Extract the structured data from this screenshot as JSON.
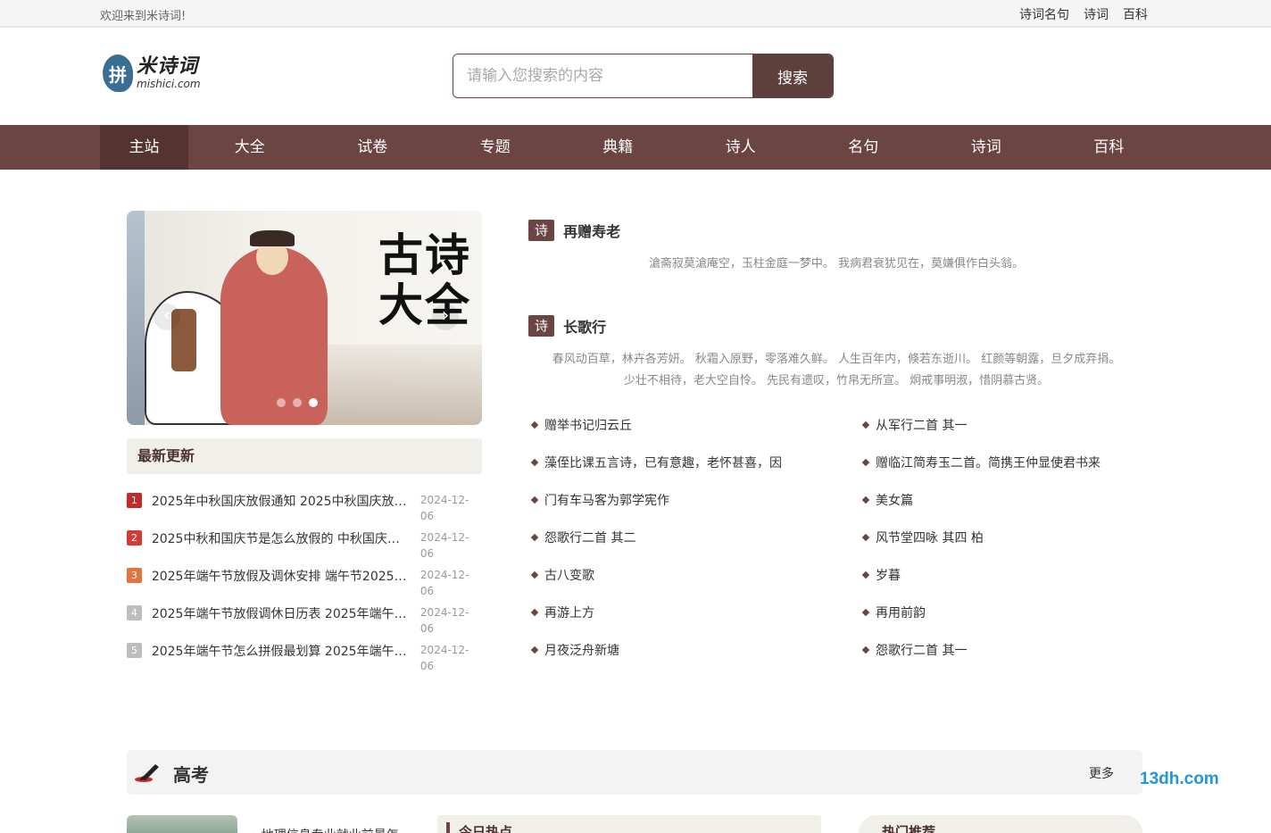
{
  "topbar": {
    "welcome": "欢迎来到米诗词!",
    "links": [
      "诗词名句",
      "诗词",
      "百科"
    ]
  },
  "logo": {
    "mark": "拼",
    "cn": "米诗词",
    "en": "mishici.com"
  },
  "search": {
    "placeholder": "请输入您搜索的内容",
    "button": "搜索"
  },
  "nav": [
    "主站",
    "大全",
    "试卷",
    "专题",
    "典籍",
    "诗人",
    "名句",
    "诗词",
    "百科"
  ],
  "banner": {
    "title_line1": "古诗",
    "title_line2": "大全"
  },
  "news": {
    "heading": "最新更新",
    "items": [
      {
        "rank": "1",
        "title": "2025年中秋国庆放假通知 2025中秋国庆放…",
        "date": "2024-12-06"
      },
      {
        "rank": "2",
        "title": "2025中秋和国庆节是怎么放假的 中秋国庆…",
        "date": "2024-12-06"
      },
      {
        "rank": "3",
        "title": "2025年端午节放假及调休安排 端午节2025…",
        "date": "2024-12-06"
      },
      {
        "rank": "4",
        "title": "2025年端午节放假调休日历表 2025年端午…",
        "date": "2024-12-06"
      },
      {
        "rank": "5",
        "title": "2025年端午节怎么拼假最划算 2025年端午…",
        "date": "2024-12-06"
      }
    ]
  },
  "poems": [
    {
      "tag": "诗",
      "title": "再赠寿老",
      "text": "滄斋寂莫滄庵空，玉柱金庭一梦中。 我病君衰犹见在，莫嫌俱作白头翁。"
    },
    {
      "tag": "诗",
      "title": "长歌行",
      "text": "春风动百草，林卉各芳妍。 秋霜入原野，零落难久鲜。 人生百年内，倏若东逝川。 红颜等朝露，旦夕成弃捐。",
      "text2": "少壮不相待，老大空自怜。 先民有遗叹，竹帛无所宣。 炯戒事明淑，惜阴慕古贤。"
    }
  ],
  "poem_links": [
    "赠举书记归云丘",
    "从军行二首 其一",
    "藻侄比课五言诗，已有意趣，老怀甚喜，因",
    "赠临江简寿玉二首。简携王仲显使君书来",
    "门有车马客为郭学宪作",
    "美女篇",
    "怨歌行二首 其二",
    "风节堂四咏 其四 柏",
    "古八变歌",
    "岁暮",
    "再游上方",
    "再用前韵",
    "月夜泛舟新塘",
    "怨歌行二首 其一"
  ],
  "section": {
    "title": "高考",
    "more": "更多",
    "watermark": "13dh.com",
    "cut_text": "• 地理信息专业就业前景怎",
    "panel2_title": "今日热点",
    "panel3_title": "热门推荐"
  },
  "colors": {
    "brand": "#6b4542",
    "brand_dark": "#553330",
    "logo_blue": "#3a6f93"
  }
}
